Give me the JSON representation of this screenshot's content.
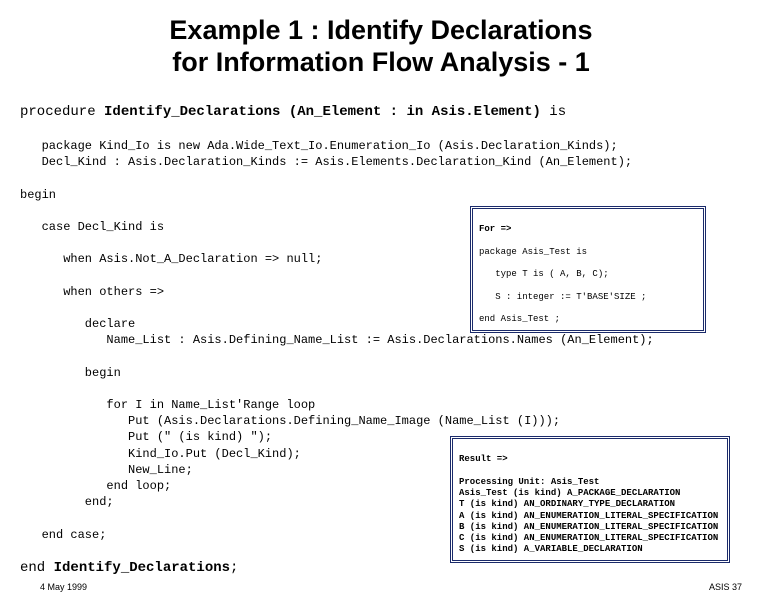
{
  "title_line1": "Example 1 : Identify Declarations",
  "title_line2": "for Information Flow Analysis - 1",
  "code": {
    "l1a": "procedure ",
    "l1b": "Identify_Declarations (An_Element : in Asis.Element) ",
    "l1c": "is",
    "l2": "   package Kind_Io is new Ada.Wide_Text_Io.Enumeration_Io (Asis.Declaration_Kinds);",
    "l3": "   Decl_Kind : Asis.Declaration_Kinds := Asis.Elements.Declaration_Kind (An_Element);",
    "l4": "begin",
    "l5": "   case Decl_Kind is",
    "l6": "      when Asis.Not_A_Declaration => null;",
    "l7": "      when others =>",
    "l8": "         declare",
    "l9": "            Name_List : Asis.Defining_Name_List := Asis.Declarations.Names (An_Element);",
    "l10": "         begin",
    "l11": "            for I in Name_List'Range loop",
    "l12": "               Put (Asis.Declarations.Defining_Name_Image (Name_List (I)));",
    "l13": "               Put (\" (is kind) \");",
    "l14": "               Kind_Io.Put (Decl_Kind);",
    "l15": "               New_Line;",
    "l16": "            end loop;",
    "l17": "         end;",
    "l18": "   end case;",
    "l19a": "end ",
    "l19b": "Identify_Declarations",
    "l19c": ";"
  },
  "box1": {
    "head": "For =>",
    "b1": "package Asis_Test is",
    "b2": "   type T is ( A, B, C);",
    "b3": "   S : integer := T'BASE'SIZE ;",
    "b4": "end Asis_Test ;"
  },
  "box2": {
    "head": "Result =>",
    "b1": "Processing Unit: Asis_Test",
    "b2": "Asis_Test (is kind) A_PACKAGE_DECLARATION",
    "b3": "T (is kind) AN_ORDINARY_TYPE_DECLARATION",
    "b4": "A (is kind) AN_ENUMERATION_LITERAL_SPECIFICATION",
    "b5": "B (is kind) AN_ENUMERATION_LITERAL_SPECIFICATION",
    "b6": "C (is kind) AN_ENUMERATION_LITERAL_SPECIFICATION",
    "b7": "S (is kind) A_VARIABLE_DECLARATION"
  },
  "footer_left": "4 May 1999",
  "footer_right": "ASIS 37"
}
